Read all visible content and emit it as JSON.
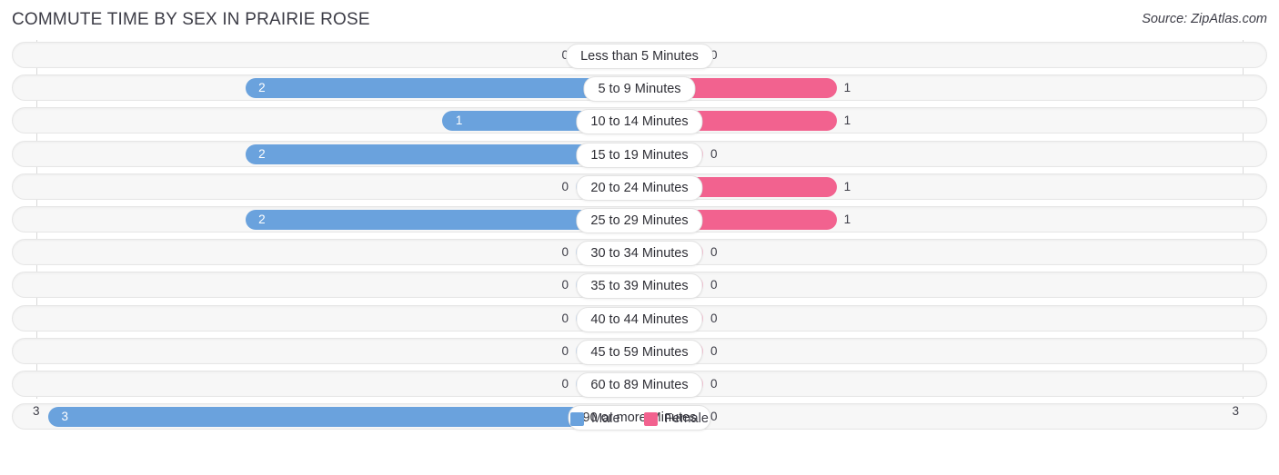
{
  "header": {
    "title": "COMMUTE TIME BY SEX IN PRAIRIE ROSE",
    "source": "Source: ZipAtlas.com"
  },
  "legend": {
    "male_label": "Male",
    "female_label": "Female"
  },
  "axis": {
    "left_label": "3",
    "right_label": "3"
  },
  "colors": {
    "male": "#6aa2dd",
    "male_zero": "#aecbef",
    "female": "#f2628f",
    "female_zero": "#f9aec7",
    "track": "#f7f7f7",
    "track_border": "#e6e6e6",
    "gridline": "#d9d9d9",
    "text": "#3c3c46"
  },
  "chart_data": {
    "type": "bar",
    "title": "COMMUTE TIME BY SEX IN PRAIRIE ROSE",
    "subtitle": "Source: ZipAtlas.com",
    "orientation": "horizontal-diverging",
    "xlabel": "",
    "ylabel": "",
    "xlim": [
      3,
      3
    ],
    "grid": true,
    "legend_position": "bottom-center",
    "categories": [
      "Less than 5 Minutes",
      "5 to 9 Minutes",
      "10 to 14 Minutes",
      "15 to 19 Minutes",
      "20 to 24 Minutes",
      "25 to 29 Minutes",
      "30 to 34 Minutes",
      "35 to 39 Minutes",
      "40 to 44 Minutes",
      "45 to 59 Minutes",
      "60 to 89 Minutes",
      "90 or more Minutes"
    ],
    "series": [
      {
        "name": "Male",
        "color": "#6aa2dd",
        "values": [
          0,
          2,
          1,
          2,
          0,
          2,
          0,
          0,
          0,
          0,
          0,
          3
        ]
      },
      {
        "name": "Female",
        "color": "#f2628f",
        "values": [
          0,
          1,
          1,
          0,
          1,
          1,
          0,
          0,
          0,
          0,
          0,
          0
        ]
      }
    ]
  },
  "rows": [
    {
      "label": "Less than 5 Minutes",
      "male": 0,
      "female": 0,
      "male_text": "0",
      "female_text": "0"
    },
    {
      "label": "5 to 9 Minutes",
      "male": 2,
      "female": 1,
      "male_text": "2",
      "female_text": "1"
    },
    {
      "label": "10 to 14 Minutes",
      "male": 1,
      "female": 1,
      "male_text": "1",
      "female_text": "1"
    },
    {
      "label": "15 to 19 Minutes",
      "male": 2,
      "female": 0,
      "male_text": "2",
      "female_text": "0"
    },
    {
      "label": "20 to 24 Minutes",
      "male": 0,
      "female": 1,
      "male_text": "0",
      "female_text": "1"
    },
    {
      "label": "25 to 29 Minutes",
      "male": 2,
      "female": 1,
      "male_text": "2",
      "female_text": "1"
    },
    {
      "label": "30 to 34 Minutes",
      "male": 0,
      "female": 0,
      "male_text": "0",
      "female_text": "0"
    },
    {
      "label": "35 to 39 Minutes",
      "male": 0,
      "female": 0,
      "male_text": "0",
      "female_text": "0"
    },
    {
      "label": "40 to 44 Minutes",
      "male": 0,
      "female": 0,
      "male_text": "0",
      "female_text": "0"
    },
    {
      "label": "45 to 59 Minutes",
      "male": 0,
      "female": 0,
      "male_text": "0",
      "female_text": "0"
    },
    {
      "label": "60 to 89 Minutes",
      "male": 0,
      "female": 0,
      "male_text": "0",
      "female_text": "0"
    },
    {
      "label": "90 or more Minutes",
      "male": 3,
      "female": 0,
      "male_text": "3",
      "female_text": "0"
    }
  ]
}
